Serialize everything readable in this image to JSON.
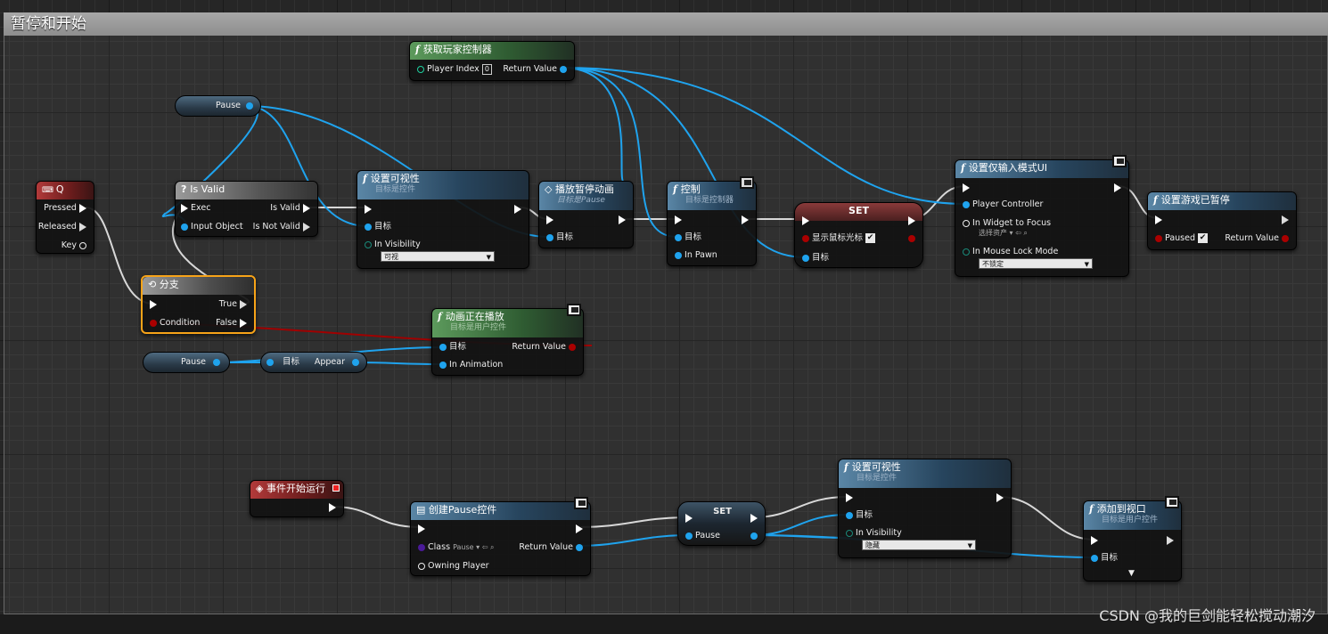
{
  "comment": {
    "title": "暂停和开始"
  },
  "nodes": {
    "get_player_controller": {
      "title": "获取玩家控制器",
      "player_index": "Player Index",
      "player_index_value": "0",
      "return_value": "Return Value"
    },
    "pause_var_top": {
      "label": "Pause"
    },
    "q_event": {
      "title": "Q",
      "pressed": "Pressed",
      "released": "Released",
      "key": "Key"
    },
    "is_valid": {
      "title": "Is Valid",
      "exec": "Exec",
      "input_object": "Input Object",
      "is_valid": "Is Valid",
      "is_not_valid": "Is Not Valid"
    },
    "set_visibility_top": {
      "title": "设置可视性",
      "subtitle": "目标是控件",
      "target": "目标",
      "in_visibility": "In Visibility",
      "visibility_value": "可视"
    },
    "play_pause_anim": {
      "title": "播放暂停动画",
      "subtitle": "目标是Pause",
      "target": "目标"
    },
    "control": {
      "title": "控制",
      "subtitle": "目标是控制器",
      "target": "目标",
      "in_pawn": "In Pawn"
    },
    "set_mouse": {
      "title": "SET",
      "label": "显示鼠标光标",
      "target": "目标"
    },
    "set_input_ui": {
      "title": "设置仅输入模式UI",
      "player_controller": "Player Controller",
      "widget_focus": "In Widget to Focus",
      "widget_value": "选择资产",
      "mouse_lock": "In Mouse Lock Mode",
      "mouse_lock_value": "不锁定"
    },
    "set_game_paused": {
      "title": "设置游戏已暂停",
      "paused": "Paused",
      "return_value": "Return Value"
    },
    "branch": {
      "title": "分支",
      "condition": "Condition",
      "true": "True",
      "false": "False"
    },
    "anim_playing": {
      "title": "动画正在播放",
      "subtitle": "目标是用户控件",
      "target": "目标",
      "in_animation": "In Animation",
      "return_value": "Return Value"
    },
    "pause_var_mid": {
      "label": "Pause"
    },
    "appear_get": {
      "target": "目标",
      "appear": "Appear"
    },
    "begin_play": {
      "title": "事件开始运行"
    },
    "create_pause": {
      "title": "创建Pause控件",
      "class": "Class",
      "class_value": "Pause",
      "owning_player": "Owning Player",
      "return_value": "Return Value"
    },
    "set_pause": {
      "title": "SET",
      "pause": "Pause"
    },
    "set_visibility_bottom": {
      "title": "设置可视性",
      "subtitle": "目标是控件",
      "target": "目标",
      "in_visibility": "In Visibility",
      "visibility_value": "隐藏"
    },
    "add_viewport": {
      "title": "添加到视口",
      "subtitle": "目标是用户控件",
      "target": "目标"
    }
  },
  "checkmark": "✔",
  "watermark": "CSDN @我的巨剑能轻松搅动潮汐",
  "colors": {
    "exec_wire": "#e6e6e6",
    "object_wire": "#1fa3ee",
    "bool_wire": "#a00000",
    "selection": "#f7a318"
  }
}
